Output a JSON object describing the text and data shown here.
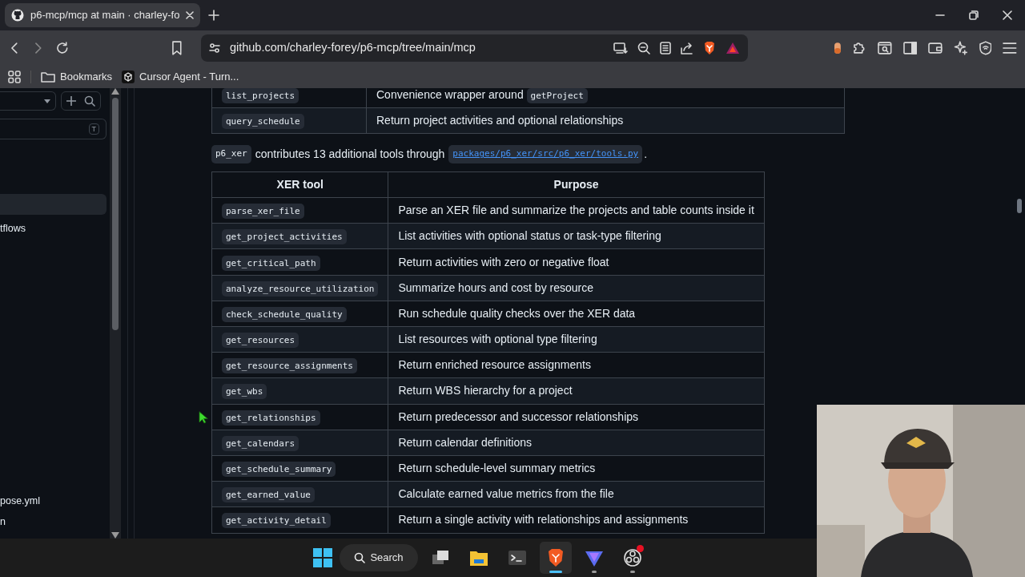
{
  "browser": {
    "tab": {
      "title": "p6-mcp/mcp at main · charley-fo",
      "selected": true
    },
    "url": "github.com/charley-forey/p6-mcp/tree/main/mcp",
    "bookmarks": [
      {
        "label": "Bookmarks",
        "kind": "folder"
      },
      {
        "label": "Cursor Agent - Turn...",
        "kind": "page"
      }
    ]
  },
  "sidebar": {
    "filter_key": "T",
    "items": [
      {
        "selected": true
      },
      {
        "label": "tflows",
        "selected": false
      },
      {
        "label": "pose.yml",
        "selected": false
      },
      {
        "label": "n",
        "selected": false
      }
    ]
  },
  "top_table": {
    "rows": [
      {
        "tool": "list_projects",
        "purpose": "Convenience wrapper around",
        "purpose_code": "getProject"
      },
      {
        "tool": "query_schedule",
        "purpose": "Return project activities and optional relationships"
      }
    ]
  },
  "paragraph": {
    "code": "p6_xer",
    "text": "contributes 13 additional tools through",
    "link": "packages/p6_xer/src/p6_xer/tools.py",
    "end": "."
  },
  "xer_table": {
    "columns": [
      "XER tool",
      "Purpose"
    ],
    "rows": [
      {
        "tool": "parse_xer_file",
        "purpose": "Parse an XER file and summarize the projects and table counts inside it"
      },
      {
        "tool": "get_project_activities",
        "purpose": "List activities with optional status or task-type filtering"
      },
      {
        "tool": "get_critical_path",
        "purpose": "Return activities with zero or negative float"
      },
      {
        "tool": "analyze_resource_utilization",
        "purpose": "Summarize hours and cost by resource"
      },
      {
        "tool": "check_schedule_quality",
        "purpose": "Run schedule quality checks over the XER data"
      },
      {
        "tool": "get_resources",
        "purpose": "List resources with optional type filtering"
      },
      {
        "tool": "get_resource_assignments",
        "purpose": "Return enriched resource assignments"
      },
      {
        "tool": "get_wbs",
        "purpose": "Return WBS hierarchy for a project"
      },
      {
        "tool": "get_relationships",
        "purpose": "Return predecessor and successor relationships"
      },
      {
        "tool": "get_calendars",
        "purpose": "Return calendar definitions"
      },
      {
        "tool": "get_schedule_summary",
        "purpose": "Return schedule-level summary metrics"
      },
      {
        "tool": "get_earned_value",
        "purpose": "Calculate earned value metrics from the file"
      },
      {
        "tool": "get_activity_detail",
        "purpose": "Return a single activity with relationships and assignments"
      }
    ]
  },
  "taskbar": {
    "search": "Search",
    "apps": [
      {
        "kind": "taskview",
        "running": false,
        "active": false,
        "badge": false
      },
      {
        "kind": "files",
        "running": false,
        "active": false,
        "badge": false
      },
      {
        "kind": "terminal",
        "running": false,
        "active": false,
        "badge": false
      },
      {
        "kind": "browser",
        "running": true,
        "active": true,
        "badge": false
      },
      {
        "kind": "vpn",
        "running": true,
        "active": false,
        "badge": false
      },
      {
        "kind": "recorder",
        "running": true,
        "active": false,
        "badge": true
      }
    ]
  }
}
